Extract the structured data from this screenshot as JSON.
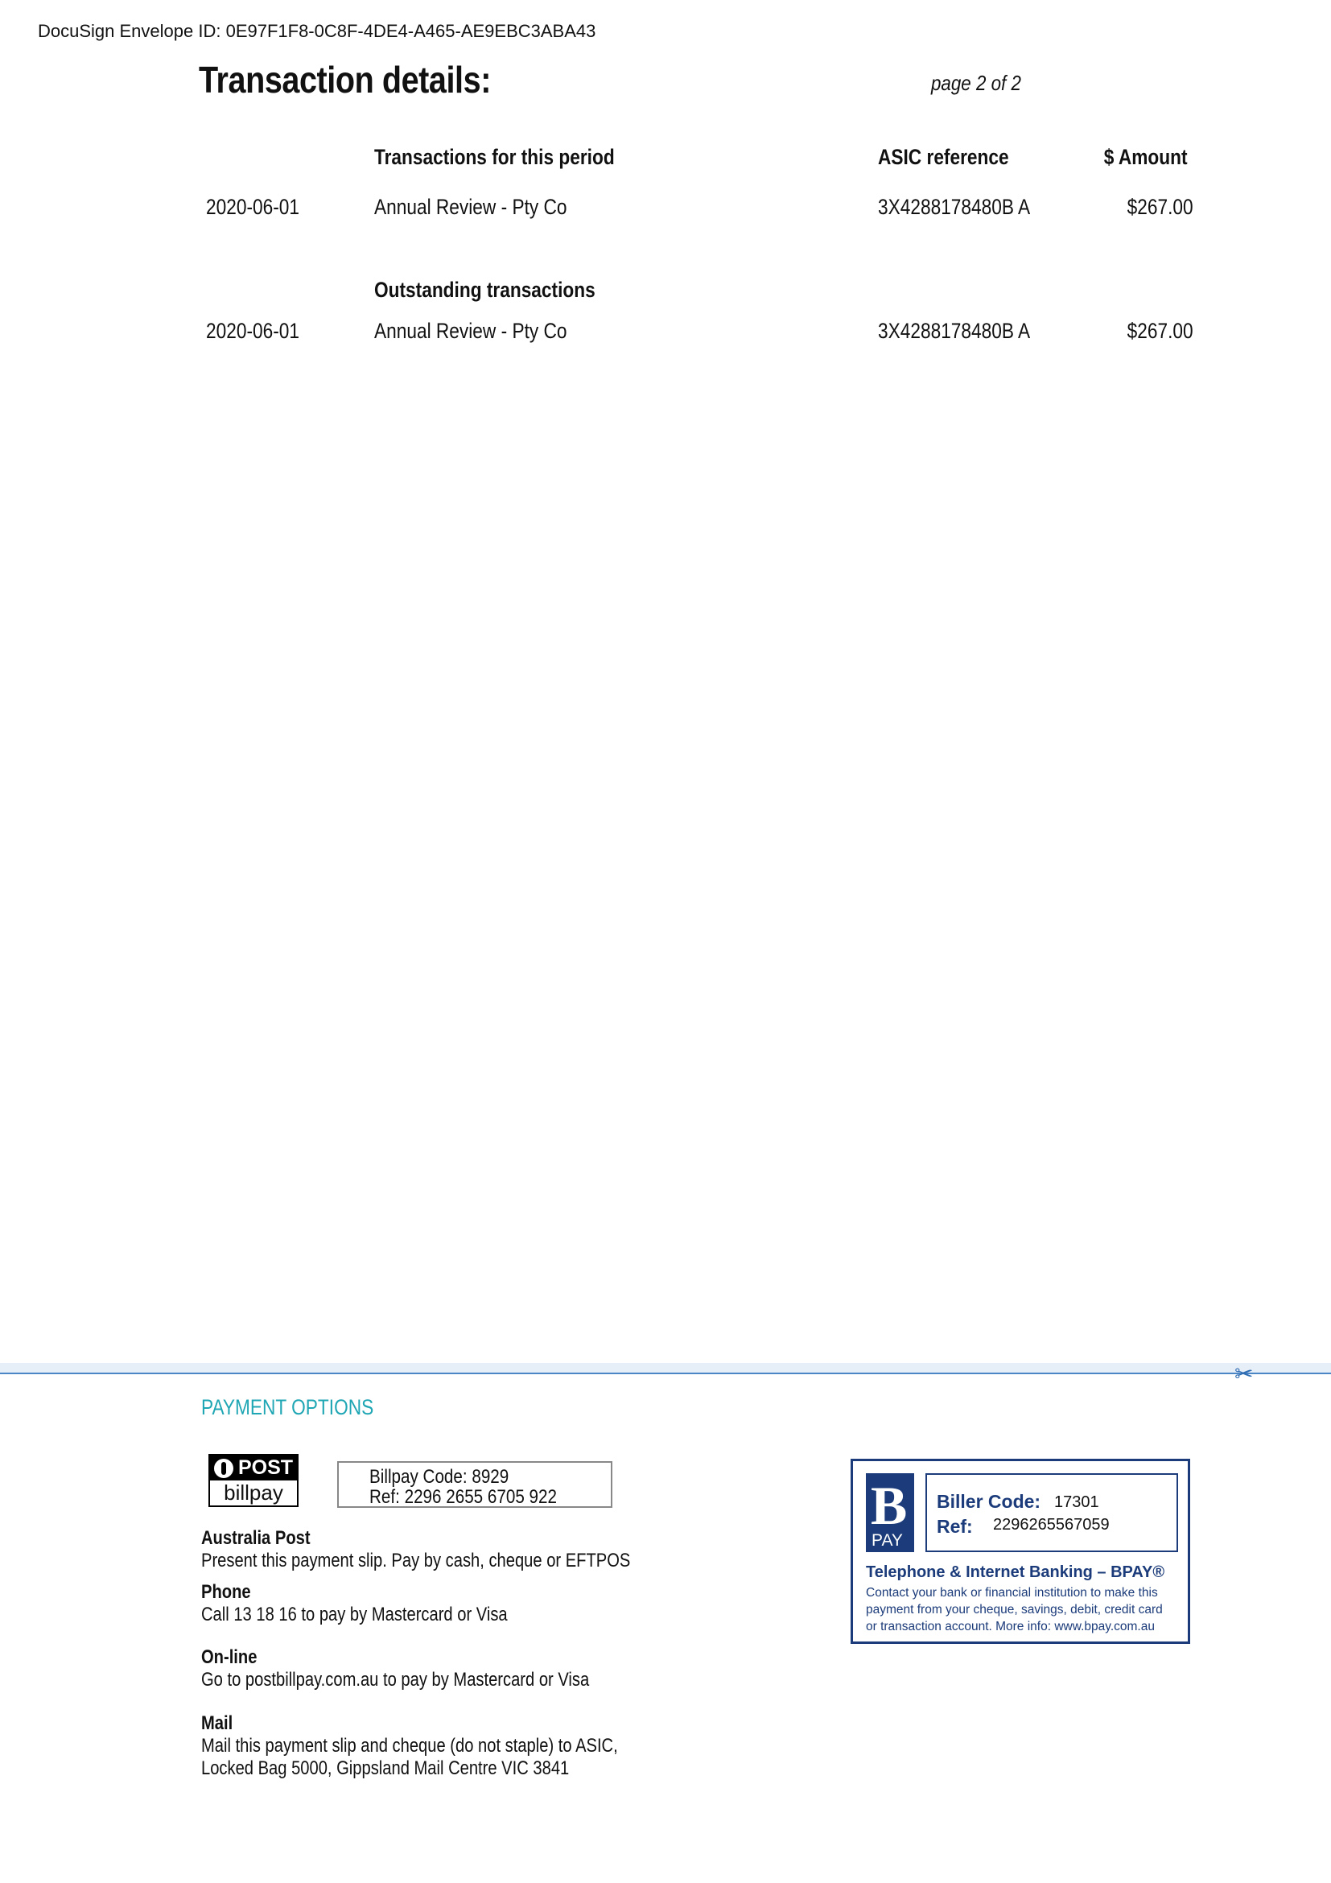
{
  "envelope_id": "DocuSign Envelope ID: 0E97F1F8-0C8F-4DE4-A465-AE9EBC3ABA43",
  "header": {
    "title": "Transaction details:",
    "page_label": "page 2 of  2"
  },
  "period": {
    "heading": "Transactions for this period",
    "col_reference": "ASIC reference",
    "col_amount": "$ Amount",
    "rows": [
      {
        "date": "2020-06-01",
        "description": "Annual Review - Pty Co",
        "reference": "3X4288178480B A",
        "amount": "$267.00"
      }
    ]
  },
  "outstanding": {
    "heading": "Outstanding transactions",
    "rows": [
      {
        "date": "2020-06-01",
        "description": "Annual Review - Pty Co",
        "reference": "3X4288178480B A",
        "amount": "$267.00"
      }
    ]
  },
  "payment": {
    "title": "PAYMENT OPTIONS",
    "post_logo_top": "POST",
    "post_logo_bottom": "billpay",
    "billpay_code": "Billpay Code: 8929",
    "billpay_ref": "Ref: 2296 2655 6705 922",
    "options": [
      {
        "heading": "Australia Post",
        "text": [
          "Present this payment slip. Pay by cash, cheque or EFTPOS"
        ]
      },
      {
        "heading": "Phone",
        "text": [
          "Call 13 18 16 to pay by Mastercard or Visa"
        ]
      },
      {
        "heading": "On-line",
        "text": [
          "Go to postbillpay.com.au to pay by Mastercard or Visa"
        ]
      },
      {
        "heading": "Mail",
        "text": [
          "Mail this payment slip and cheque (do not staple) to ASIC,",
          "Locked Bag 5000, Gippsland Mail Centre VIC 3841"
        ]
      }
    ],
    "bpay": {
      "logo_letter": "B",
      "logo_word": "PAY",
      "biller_label": "Biller Code:",
      "biller_code": "17301",
      "ref_label": "Ref:",
      "ref_value": "2296265567059",
      "heading": "Telephone & Internet Banking – BPAY®",
      "lines": [
        "Contact your bank or financial institution to make this",
        "payment from your cheque, savings, debit, credit card",
        "or transaction account. More info: www.bpay.com.au"
      ]
    }
  },
  "colors": {
    "bpay_blue": "#1b3b7a",
    "payment_title": "#1fa6b4",
    "cut_line": "#4a86c5"
  }
}
